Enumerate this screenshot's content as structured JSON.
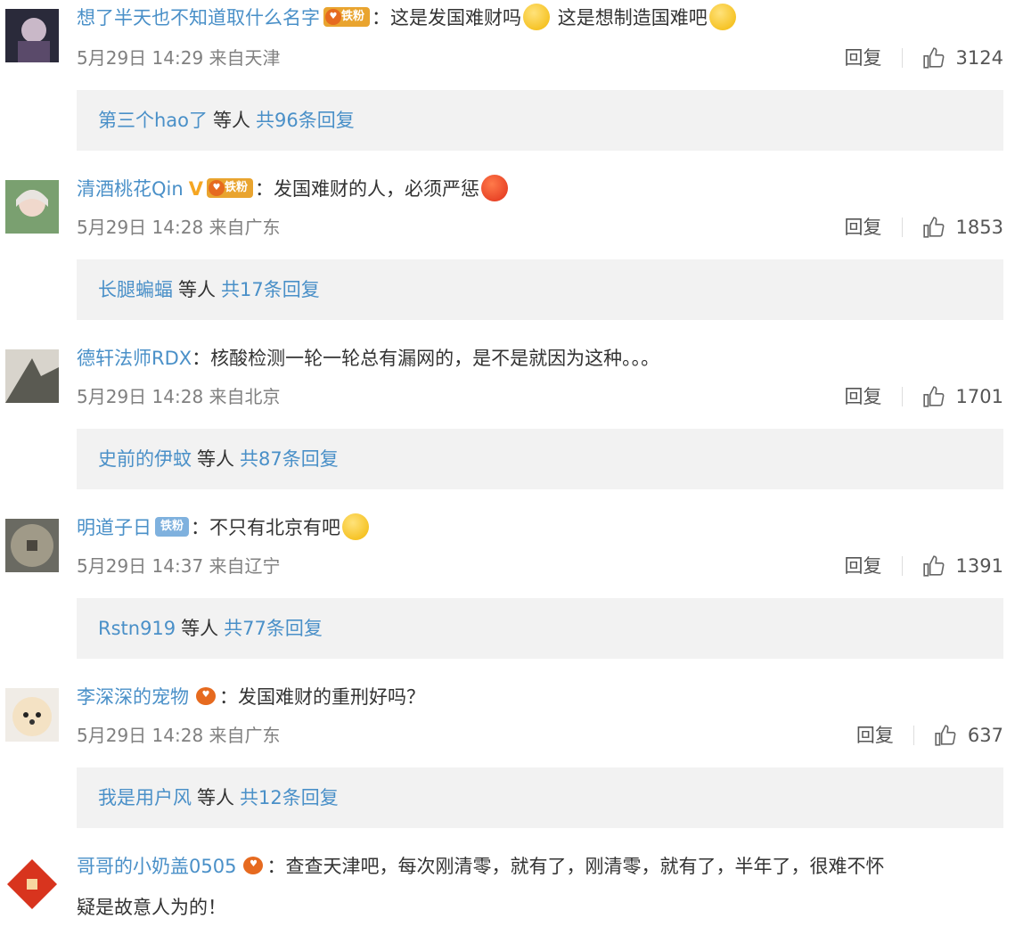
{
  "colors": {
    "link": "#4a90c8",
    "meta": "#808080",
    "badge": "#e9a42f",
    "subreply_bg": "#f2f2f2"
  },
  "comments": [
    {
      "username": "想了半天也不知道取什么名字",
      "badge": "铁粉",
      "text": "：这是发国难财吗",
      "text2": "这是想制造国难吧",
      "date": "5月29日 14:29 来自天津",
      "reply": "回复",
      "likes": "3124",
      "sub_name": "第三个hao了",
      "sub_mid": "等人",
      "sub_count": "共96条回复",
      "icons": [
        "avatar",
        "fan-badge-icon",
        "emoji-icon",
        "emoji-icon",
        "like-icon"
      ]
    },
    {
      "username": "清酒桃花Qin",
      "vmark": "V",
      "badge": "铁粉",
      "text": "：发国难财的人，必须严惩",
      "date": "5月29日 14:28 来自广东",
      "reply": "回复",
      "likes": "1853",
      "sub_name": "长腿蝙蝠",
      "sub_mid": "等人",
      "sub_count": "共17条回复"
    },
    {
      "username": "德轩法师RDX",
      "text": "：核酸检测一轮一轮总有漏网的，是不是就因为这种。。。",
      "date": "5月29日 14:28 来自北京",
      "reply": "回复",
      "likes": "1701",
      "sub_name": "史前的伊蚊",
      "sub_mid": "等人",
      "sub_count": "共87条回复"
    },
    {
      "username": "明道子日",
      "badge": "铁粉",
      "text": "：不只有北京有吧",
      "date": "5月29日 14:37 来自辽宁",
      "reply": "回复",
      "likes": "1391",
      "sub_name": "Rstn919",
      "sub_mid": "等人",
      "sub_count": "共77条回复"
    },
    {
      "username": "李深深的宠物",
      "text": "：发国难财的重刑好吗？",
      "date": "5月29日 14:28 来自广东",
      "reply": "回复",
      "likes": "637",
      "sub_name": "我是用户风",
      "sub_mid": "等人",
      "sub_count": "共12条回复"
    },
    {
      "username": "哥哥的小奶盖0505",
      "text": "：查查天津吧，每次刚清零，就有了，刚清零，就有了，半年了，很难不怀",
      "text_cont": "疑是故意人为的！"
    }
  ]
}
